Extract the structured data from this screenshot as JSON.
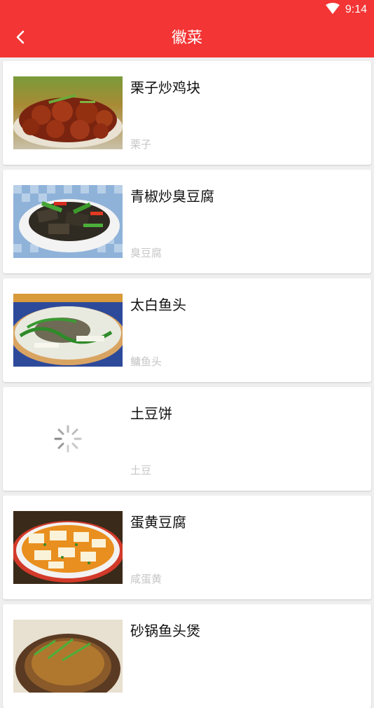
{
  "status": {
    "time": "9:14"
  },
  "header": {
    "title": "徽菜"
  },
  "colors": {
    "accent": "#f33535"
  },
  "recipes": [
    {
      "name": "栗子炒鸡块",
      "ingredient": "栗子",
      "image": "chicken-chestnut"
    },
    {
      "name": "青椒炒臭豆腐",
      "ingredient": "臭豆腐",
      "image": "tofu-pepper"
    },
    {
      "name": "太白鱼头",
      "ingredient": "鳙鱼头",
      "image": "fish-head"
    },
    {
      "name": "土豆饼",
      "ingredient": "土豆",
      "image": "loading"
    },
    {
      "name": "蛋黄豆腐",
      "ingredient": "咸蛋黄",
      "image": "egg-tofu"
    },
    {
      "name": "砂锅鱼头煲",
      "ingredient": "",
      "image": "clay-pot"
    }
  ]
}
